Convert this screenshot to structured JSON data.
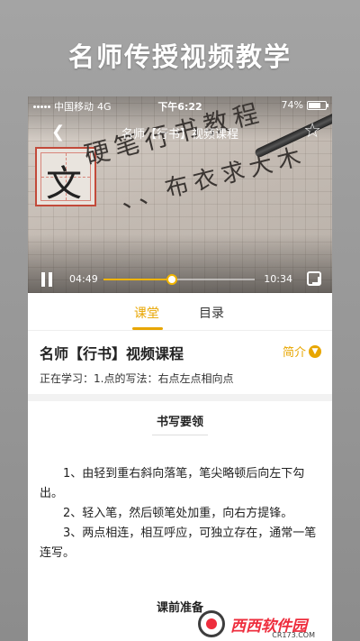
{
  "promo": {
    "title": "名师传授视频教学"
  },
  "status_bar": {
    "carrier": "中国移动",
    "network": "4G",
    "time": "下午6:22",
    "battery": "74%",
    "battery_level": 0.74
  },
  "video": {
    "title": "名师【行书】视频课程",
    "current_time": "04:49",
    "total_time": "10:34",
    "progress": 0.455
  },
  "tabs": [
    {
      "label": "课堂",
      "active": true
    },
    {
      "label": "目录",
      "active": false
    }
  ],
  "course": {
    "title": "名师【行书】视频课程",
    "intro_label": "简介",
    "learning": "正在学习：1.点的写法：右点左点相向点"
  },
  "writing_points": {
    "title": "书写要领",
    "paragraphs": [
      "1、由轻到重右斜向落笔，笔尖略顿后向左下勾出。",
      "2、轻入笔，然后顿笔处加重，向右方提锋。",
      "3、两点相连，相互呼应，可独立存在，通常一笔连写。"
    ]
  },
  "next_section": {
    "title": "课前准备"
  },
  "watermark": {
    "text": "西西软件园",
    "sub": "CR173.COM"
  },
  "colors": {
    "accent": "#e8a600"
  }
}
